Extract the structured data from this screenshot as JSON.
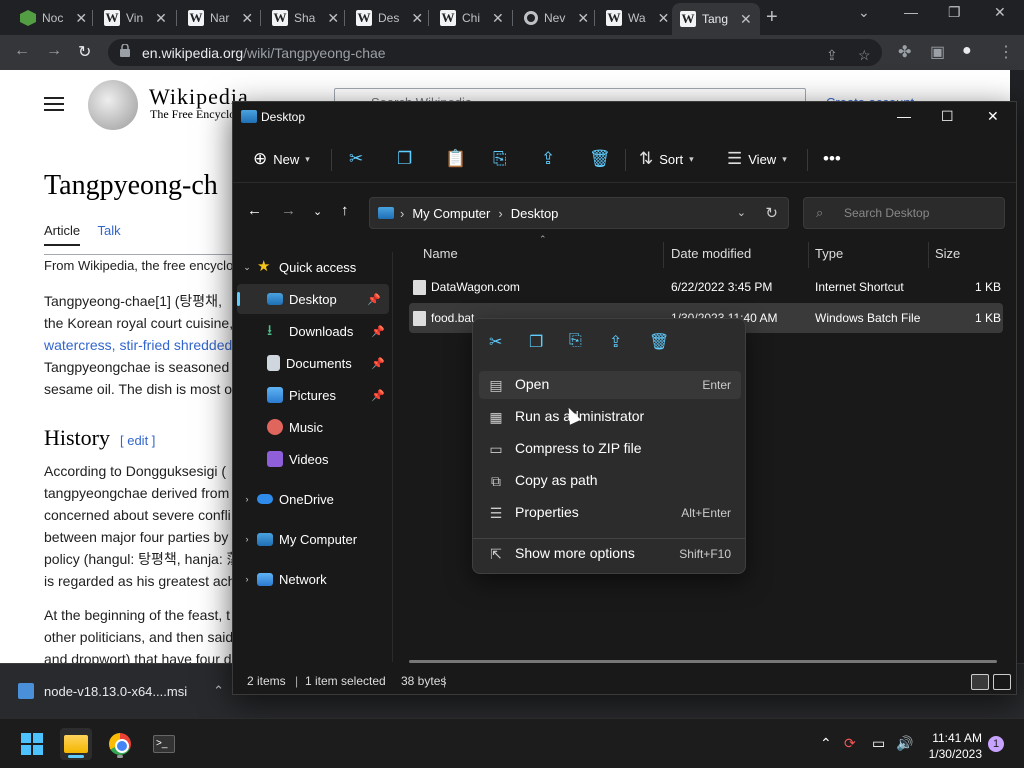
{
  "browser": {
    "tabs": [
      {
        "label": "Noc",
        "icon": "nodejs-icon"
      },
      {
        "label": "Vin",
        "icon": "wikipedia-icon"
      },
      {
        "label": "Nar",
        "icon": "wikipedia-icon"
      },
      {
        "label": "Sha",
        "icon": "wikipedia-icon"
      },
      {
        "label": "Des",
        "icon": "wikipedia-icon"
      },
      {
        "label": "Chi",
        "icon": "wikipedia-icon"
      },
      {
        "label": "Nev",
        "icon": "google-icon"
      },
      {
        "label": "Wa",
        "icon": "wikipedia-icon"
      },
      {
        "label": "Tang",
        "icon": "wikipedia-icon",
        "active": true
      }
    ],
    "url_domain": "en.wikipedia.org",
    "url_path": "/wiki/Tangpyeong-chae",
    "download": {
      "filename": "node-v18.13.0-x64....msi"
    }
  },
  "wiki": {
    "wordmark": "Wikipedia",
    "tagline": "The Free Encyclo",
    "search_placeholder": "Search Wikipedia",
    "create_account": "Create account",
    "title": "Tangpyeong-ch",
    "tab_article": "Article",
    "tab_talk": "Talk",
    "from_line": "From Wikipedia, the free encyclo",
    "para1": [
      "Tangpyeong-chae[1] (탕평채,",
      "the Korean royal court cuisine,",
      "watercress, stir-fried shredded",
      "Tangpyeongchae is seasoned",
      "sesame oil. The dish is most o"
    ],
    "history_heading": "History",
    "edit_link": "[ edit ]",
    "para2": [
      "According to Dongguksesigi (",
      "tangpyeongchae derived from",
      "concerned about severe confli",
      "between major four parties by",
      "policy (hangul: 탕평책, hanja: 蕩",
      "is regarded as his greatest ach"
    ],
    "para3": [
      "At the beginning of the feast, t",
      "other politicians, and then said",
      "and dropwort) that have four d"
    ]
  },
  "explorer": {
    "title": "Desktop",
    "new_label": "New",
    "sort_label": "Sort",
    "view_label": "View",
    "breadcrumb": [
      "My Computer",
      "Desktop"
    ],
    "search_placeholder": "Search Desktop",
    "nav": {
      "quick_access": "Quick access",
      "desktop": "Desktop",
      "downloads": "Downloads",
      "documents": "Documents",
      "pictures": "Pictures",
      "music": "Music",
      "videos": "Videos",
      "onedrive": "OneDrive",
      "my_computer": "My Computer",
      "network": "Network"
    },
    "columns": {
      "name": "Name",
      "date": "Date modified",
      "type": "Type",
      "size": "Size"
    },
    "files": [
      {
        "name": "DataWagon.com",
        "date": "6/22/2022 3:45 PM",
        "type": "Internet Shortcut",
        "size": "1 KB"
      },
      {
        "name": "food.bat",
        "date": "1/30/2023 11:40 AM",
        "type": "Windows Batch File",
        "size": "1 KB"
      }
    ],
    "status": {
      "count": "2 items",
      "selected": "1 item selected",
      "bytes": "38 bytes"
    }
  },
  "context_menu": {
    "items": [
      {
        "label": "Open",
        "shortcut": "Enter"
      },
      {
        "label": "Run as administrator",
        "shortcut": ""
      },
      {
        "label": "Compress to ZIP file",
        "shortcut": ""
      },
      {
        "label": "Copy as path",
        "shortcut": ""
      },
      {
        "label": "Properties",
        "shortcut": "Alt+Enter"
      },
      {
        "label": "Show more options",
        "shortcut": "Shift+F10"
      }
    ]
  },
  "taskbar": {
    "time": "11:41 AM",
    "date": "1/30/2023",
    "notifications": "1"
  }
}
